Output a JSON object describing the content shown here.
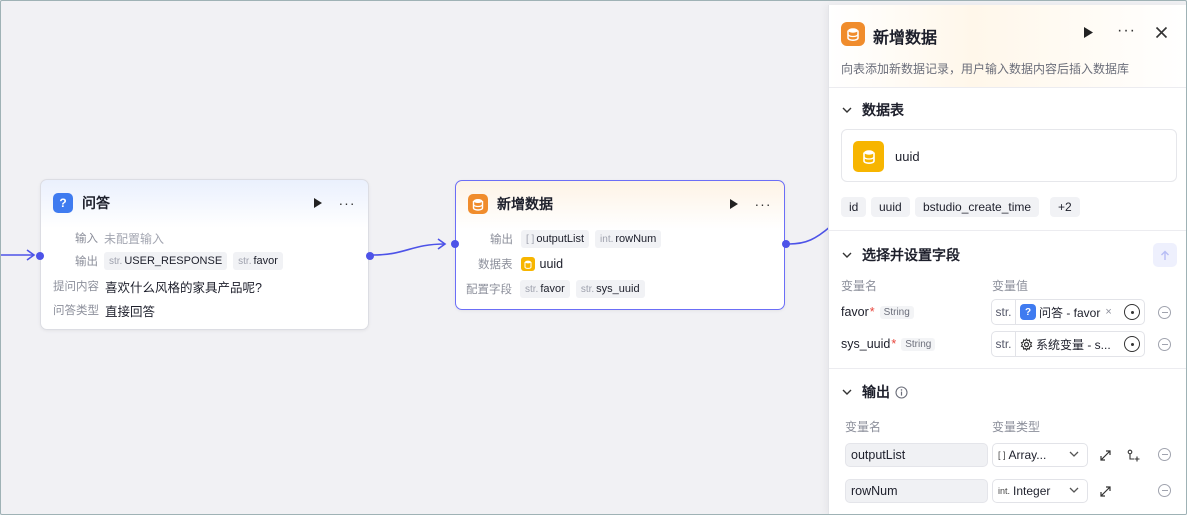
{
  "canvas": {
    "qa_node": {
      "title": "问答",
      "input_label": "输入",
      "input_value": "未配置输入",
      "output_label": "输出",
      "outputs": [
        {
          "type": "str.",
          "name": "USER_RESPONSE"
        },
        {
          "type": "str.",
          "name": "favor"
        }
      ],
      "question_label": "提问内容",
      "question_value": "喜欢什么风格的家具产品呢?",
      "answer_type_label": "问答类型",
      "answer_type_value": "直接回答"
    },
    "add_node": {
      "title": "新增数据",
      "output_label": "输出",
      "outputs": [
        {
          "type": "[ ]",
          "name": "outputList"
        },
        {
          "type": "int.",
          "name": "rowNum"
        }
      ],
      "table_label": "数据表",
      "table_value": "uuid",
      "fields_label": "配置字段",
      "fields": [
        {
          "type": "str.",
          "name": "favor"
        },
        {
          "type": "str.",
          "name": "sys_uuid"
        }
      ]
    },
    "colors": {
      "edge": "#4d53e8",
      "selected_border": "#6b6ef7",
      "qa_icon": "#3f7bf0",
      "db_icon": "#f08c2c",
      "table_icon": "#f7b500"
    }
  },
  "panel": {
    "title": "新增数据",
    "description": "向表添加新数据记录，用户输入数据内容后插入数据库",
    "table_section": {
      "title": "数据表",
      "table_name": "uuid",
      "columns": [
        "id",
        "uuid",
        "bstudio_create_time",
        "+2"
      ]
    },
    "fields_section": {
      "title": "选择并设置字段",
      "col_name": "变量名",
      "col_value": "变量值",
      "rows": [
        {
          "name": "favor",
          "type": "String",
          "prefix": "str.",
          "value": "问答 - favor"
        },
        {
          "name": "sys_uuid",
          "type": "String",
          "prefix": "str.",
          "value": "系统变量 - s..."
        }
      ]
    },
    "output_section": {
      "title": "输出",
      "col_name": "变量名",
      "col_type": "变量类型",
      "rows": [
        {
          "name": "outputList",
          "type_icon": "[ ]",
          "type": "Array..."
        },
        {
          "name": "rowNum",
          "type_icon": "int.",
          "type": "Integer"
        }
      ]
    }
  }
}
